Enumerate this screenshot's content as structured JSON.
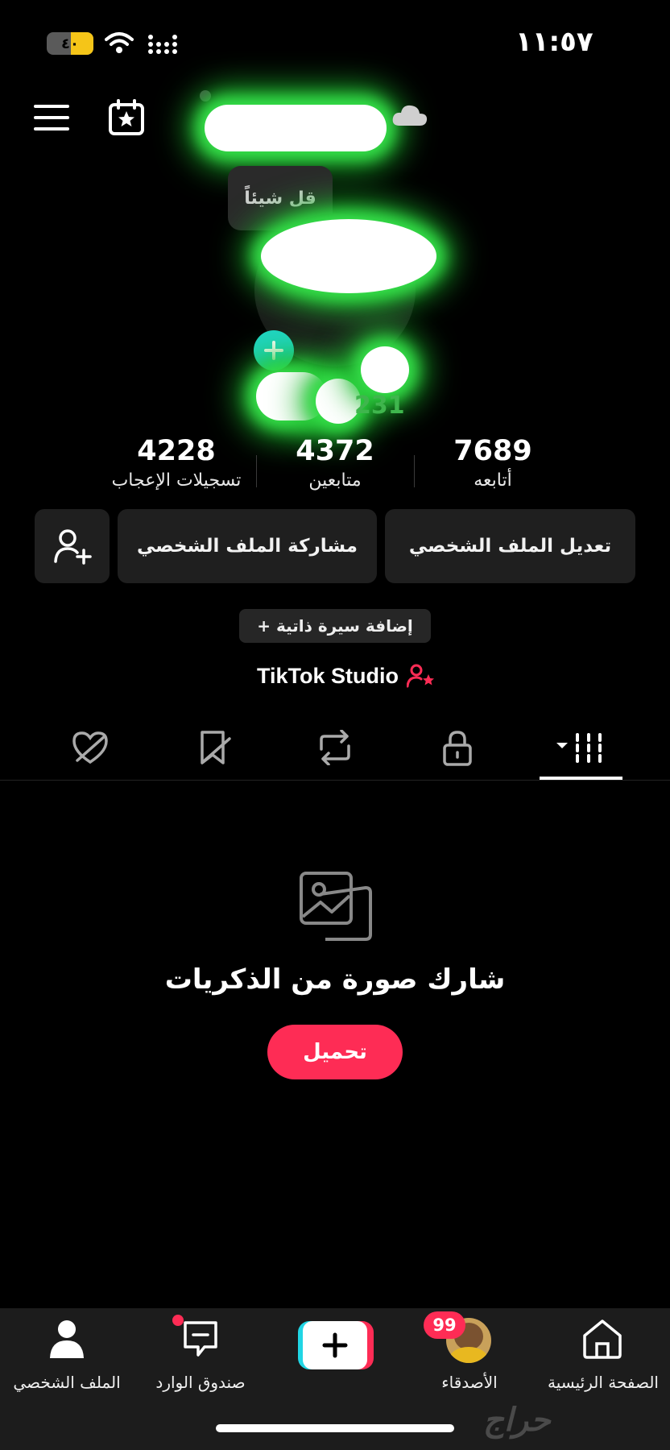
{
  "status_bar": {
    "time": "١١:٥٧",
    "battery": "٤٠"
  },
  "profile": {
    "say_something": "قل شيئاً",
    "partial_username": "231"
  },
  "stats": [
    {
      "value": "7689",
      "label": "أتابعه"
    },
    {
      "value": "4372",
      "label": "متابعين"
    },
    {
      "value": "4228",
      "label": "تسجيلات الإعجاب"
    }
  ],
  "actions": {
    "edit_profile": "تعديل الملف الشخصي",
    "share_profile": "مشاركة الملف الشخصي"
  },
  "bio": {
    "add_bio": "+ إضافة سيرة ذاتية"
  },
  "studio": {
    "label": "TikTok Studio"
  },
  "empty_state": {
    "title": "شارك صورة من الذكريات",
    "upload_button": "تحميل"
  },
  "bottom_nav": {
    "home": "الصفحة الرئيسية",
    "friends": "الأصدقاء",
    "friends_badge": "99",
    "inbox": "صندوق الوارد",
    "profile": "الملف الشخصي"
  },
  "watermark": {
    "text": "حراج"
  },
  "colors": {
    "accent": "#fe2c55",
    "glow": "#36e04a",
    "background": "#000000",
    "button_bg": "#1f1f1f",
    "plus_teal": "#20d5c4"
  }
}
